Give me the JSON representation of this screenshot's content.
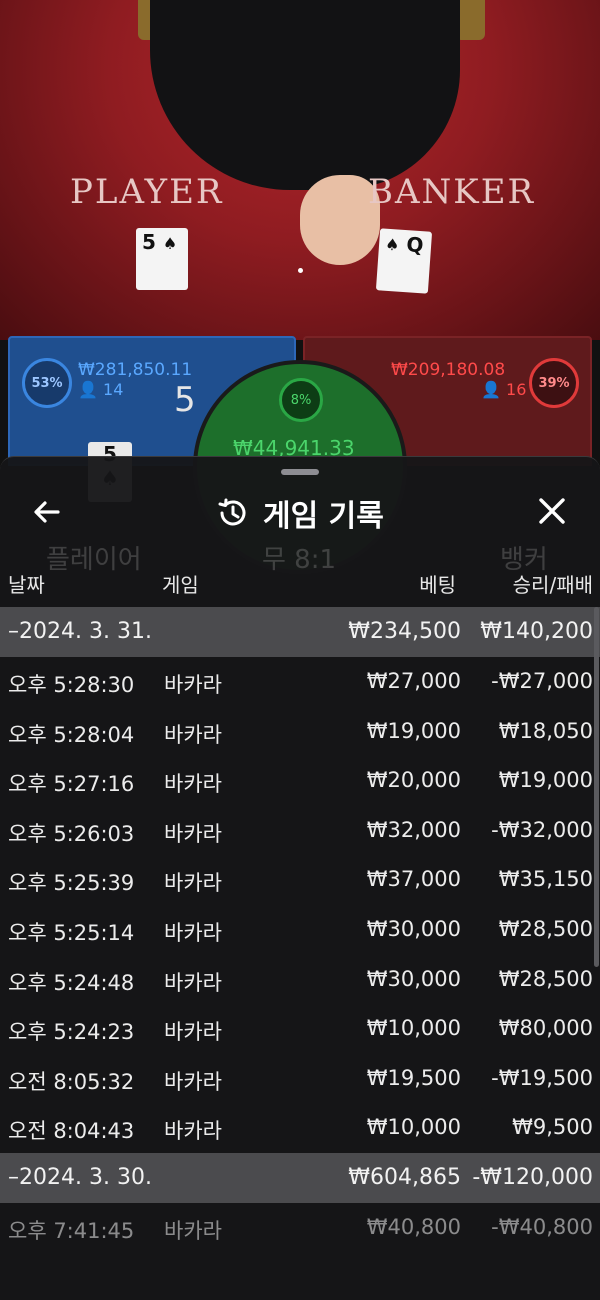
{
  "game": {
    "player_label": "PLAYER",
    "banker_label": "BANKER",
    "player_card": {
      "rank": "5",
      "suit": "♠"
    },
    "banker_card": {
      "rank": "Q",
      "suit": "♠"
    },
    "player": {
      "percent": "53%",
      "amount": "₩281,850.11",
      "bettors": "14",
      "score": "5",
      "mini_card": "5",
      "mini_card_suit": "♠"
    },
    "banker": {
      "percent": "39%",
      "amount": "₩209,180.08",
      "bettors": "16"
    },
    "tie": {
      "percent": "8%",
      "amount": "₩44,941.33"
    },
    "tabs_behind": [
      "플레이어",
      "무 8:1",
      "뱅커"
    ]
  },
  "history": {
    "title": "게임 기록",
    "back_icon": "back-arrow-icon",
    "history_icon": "history-clock-icon",
    "close_icon": "close-icon",
    "columns": {
      "date": "날짜",
      "game": "게임",
      "bet": "베팅",
      "result": "승리/패배"
    },
    "groups": [
      {
        "date": "–2024. 3. 31.",
        "total_bet": "₩234,500",
        "total_result": "₩140,200",
        "rows": [
          {
            "time": "오후 5:28:30",
            "game": "바카라",
            "bet": "₩27,000",
            "result": "-₩27,000"
          },
          {
            "time": "오후 5:28:04",
            "game": "바카라",
            "bet": "₩19,000",
            "result": "₩18,050"
          },
          {
            "time": "오후 5:27:16",
            "game": "바카라",
            "bet": "₩20,000",
            "result": "₩19,000"
          },
          {
            "time": "오후 5:26:03",
            "game": "바카라",
            "bet": "₩32,000",
            "result": "-₩32,000"
          },
          {
            "time": "오후 5:25:39",
            "game": "바카라",
            "bet": "₩37,000",
            "result": "₩35,150"
          },
          {
            "time": "오후 5:25:14",
            "game": "바카라",
            "bet": "₩30,000",
            "result": "₩28,500"
          },
          {
            "time": "오후 5:24:48",
            "game": "바카라",
            "bet": "₩30,000",
            "result": "₩28,500"
          },
          {
            "time": "오후 5:24:23",
            "game": "바카라",
            "bet": "₩10,000",
            "result": "₩80,000"
          },
          {
            "time": "오전 8:05:32",
            "game": "바카라",
            "bet": "₩19,500",
            "result": "-₩19,500"
          },
          {
            "time": "오전 8:04:43",
            "game": "바카라",
            "bet": "₩10,000",
            "result": "₩9,500"
          }
        ]
      },
      {
        "date": "–2024. 3. 30.",
        "total_bet": "₩604,865",
        "total_result": "-₩120,000",
        "rows": [
          {
            "time": "오후 7:41:45",
            "game": "바카라",
            "bet": "₩40,800",
            "result": "-₩40,800"
          }
        ]
      }
    ]
  }
}
